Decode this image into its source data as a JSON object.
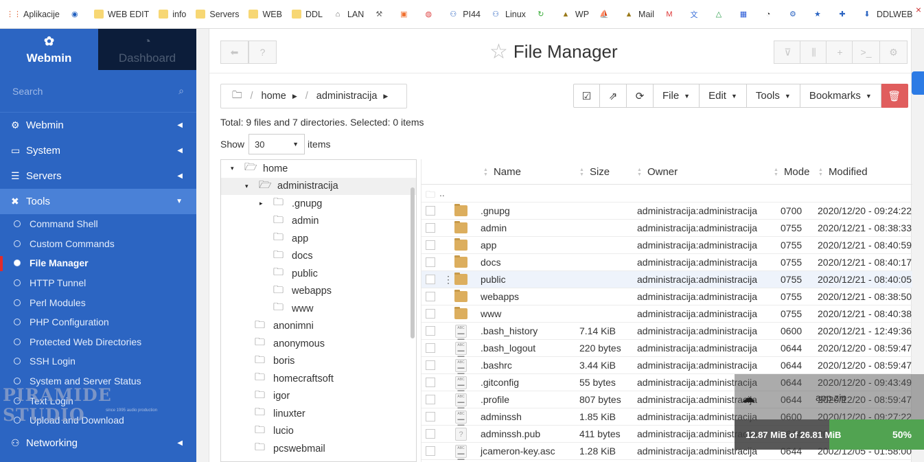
{
  "bookmarks": [
    {
      "label": "Aplikacije",
      "icon": "apps-grid-icon"
    },
    {
      "label": "",
      "icon": "radio-icon"
    },
    {
      "label": "WEB EDIT",
      "icon": "folder-icon"
    },
    {
      "label": "info",
      "icon": "folder-icon"
    },
    {
      "label": "Servers",
      "icon": "folder-icon"
    },
    {
      "label": "WEB",
      "icon": "folder-icon"
    },
    {
      "label": "DDL",
      "icon": "folder-icon"
    },
    {
      "label": "LAN",
      "icon": "lan-icon"
    },
    {
      "label": "",
      "icon": "tools-icon"
    },
    {
      "label": "",
      "icon": "box-icon"
    },
    {
      "label": "",
      "icon": "circle-logo-icon"
    },
    {
      "label": "PI44",
      "icon": "network-icon"
    },
    {
      "label": "Linux",
      "icon": "network-icon"
    },
    {
      "label": "",
      "icon": "refresh-green-icon"
    },
    {
      "label": "WP",
      "icon": "triangle-icon"
    },
    {
      "label": "",
      "icon": "pma-icon"
    },
    {
      "label": "Mail",
      "icon": "triangle-icon"
    },
    {
      "label": "",
      "icon": "gmail-icon"
    },
    {
      "label": "",
      "icon": "translate-icon"
    },
    {
      "label": "",
      "icon": "drive-icon"
    },
    {
      "label": "",
      "icon": "calendar-icon"
    },
    {
      "label": "",
      "icon": "gauge-icon"
    },
    {
      "label": "",
      "icon": "gear-icon"
    },
    {
      "label": "",
      "icon": "star-icon"
    },
    {
      "label": "",
      "icon": "puzzle-icon"
    },
    {
      "label": "DDLWEB",
      "icon": "download-icon"
    }
  ],
  "sidebar": {
    "tab_webmin": "Webmin",
    "tab_dashboard": "Dashboard",
    "search_placeholder": "Search",
    "categories_top": [
      {
        "label": "Webmin",
        "icon": "gear-icon"
      },
      {
        "label": "System",
        "icon": "monitor-icon"
      },
      {
        "label": "Servers",
        "icon": "servers-icon"
      }
    ],
    "tools_label": "Tools",
    "tools_items": [
      "Command Shell",
      "Custom Commands",
      "File Manager",
      "HTTP Tunnel",
      "Perl Modules",
      "PHP Configuration",
      "Protected Web Directories",
      "SSH Login",
      "System and Server Status",
      "Text Login",
      "Upload and Download"
    ],
    "networking_label": "Networking",
    "watermark": "PIRAMIDE STUDIO",
    "watermark_sub": "since 1995 audio production"
  },
  "main": {
    "title": "File Manager",
    "breadcrumb": {
      "home": "home",
      "folder": "administracija"
    },
    "actions": {
      "file": "File",
      "edit": "Edit",
      "tools": "Tools",
      "bookmarks": "Bookmarks"
    },
    "summary": "Total: 9 files and 7 directories. Selected: 0 items",
    "show_label": "Show",
    "per_page": "30",
    "items_label": "items"
  },
  "tree": [
    {
      "label": "home",
      "level": 0,
      "expanded": true,
      "toggle": "▾"
    },
    {
      "label": "administracija",
      "level": 1,
      "expanded": true,
      "toggle": "▾",
      "selected": true
    },
    {
      "label": ".gnupg",
      "level": 2,
      "toggle": "▸"
    },
    {
      "label": "admin",
      "level": 2,
      "toggle": ""
    },
    {
      "label": "app",
      "level": 2,
      "toggle": ""
    },
    {
      "label": "docs",
      "level": 2,
      "toggle": ""
    },
    {
      "label": "public",
      "level": 2,
      "toggle": ""
    },
    {
      "label": "webapps",
      "level": 2,
      "toggle": ""
    },
    {
      "label": "www",
      "level": 2,
      "toggle": ""
    },
    {
      "label": "anonimni",
      "level": 1,
      "toggle": ""
    },
    {
      "label": "anonymous",
      "level": 1,
      "toggle": ""
    },
    {
      "label": "boris",
      "level": 1,
      "toggle": ""
    },
    {
      "label": "homecraftsoft",
      "level": 1,
      "toggle": ""
    },
    {
      "label": "igor",
      "level": 1,
      "toggle": ""
    },
    {
      "label": "linuxter",
      "level": 1,
      "toggle": ""
    },
    {
      "label": "lucio",
      "level": 1,
      "toggle": ""
    },
    {
      "label": "pcswebmail",
      "level": 1,
      "toggle": ""
    }
  ],
  "table": {
    "columns": {
      "name": "Name",
      "size": "Size",
      "owner": "Owner",
      "mode": "Mode",
      "modified": "Modified"
    },
    "parent": "..",
    "rows": [
      {
        "name": ".gnupg",
        "size": "",
        "owner": "administracija:administracija",
        "mode": "0700",
        "modified": "2020/12/20 - 09:24:22",
        "type": "dir"
      },
      {
        "name": "admin",
        "size": "",
        "owner": "administracija:administracija",
        "mode": "0755",
        "modified": "2020/12/21 - 08:38:33",
        "type": "dir"
      },
      {
        "name": "app",
        "size": "",
        "owner": "administracija:administracija",
        "mode": "0755",
        "modified": "2020/12/21 - 08:40:59",
        "type": "dir"
      },
      {
        "name": "docs",
        "size": "",
        "owner": "administracija:administracija",
        "mode": "0755",
        "modified": "2020/12/21 - 08:40:17",
        "type": "dir"
      },
      {
        "name": "public",
        "size": "",
        "owner": "administracija:administracija",
        "mode": "0755",
        "modified": "2020/12/21 - 08:40:05",
        "type": "dir",
        "hover": true
      },
      {
        "name": "webapps",
        "size": "",
        "owner": "administracija:administracija",
        "mode": "0755",
        "modified": "2020/12/21 - 08:38:50",
        "type": "dir"
      },
      {
        "name": "www",
        "size": "",
        "owner": "administracija:administracija",
        "mode": "0755",
        "modified": "2020/12/21 - 08:40:38",
        "type": "dir"
      },
      {
        "name": ".bash_history",
        "size": "7.14 KiB",
        "owner": "administracija:administracija",
        "mode": "0600",
        "modified": "2020/12/21 - 12:49:36",
        "type": "text"
      },
      {
        "name": ".bash_logout",
        "size": "220 bytes",
        "owner": "administracija:administracija",
        "mode": "0644",
        "modified": "2020/12/20 - 08:59:47",
        "type": "text"
      },
      {
        "name": ".bashrc",
        "size": "3.44 KiB",
        "owner": "administracija:administracija",
        "mode": "0644",
        "modified": "2020/12/20 - 08:59:47",
        "type": "text"
      },
      {
        "name": ".gitconfig",
        "size": "55 bytes",
        "owner": "administracija:administracija",
        "mode": "0644",
        "modified": "2020/12/20 - 09:43:49",
        "type": "text"
      },
      {
        "name": ".profile",
        "size": "807 bytes",
        "owner": "administracija:administracija",
        "mode": "0644",
        "modified": "2020/12/20 - 08:59:47",
        "type": "text"
      },
      {
        "name": "adminssh",
        "size": "1.85 KiB",
        "owner": "administracija:administracija",
        "mode": "0600",
        "modified": "2020/12/20 - 09:27:22",
        "type": "text"
      },
      {
        "name": "adminssh.pub",
        "size": "411 bytes",
        "owner": "administracija:administracija",
        "mode": "0644",
        "modified": "2020/12/20 - 09:27:22",
        "type": "unknown"
      },
      {
        "name": "jcameron-key.asc",
        "size": "1.28 KiB",
        "owner": "administracija:administracija",
        "mode": "0644",
        "modified": "2002/12/05 - 01:58:00",
        "type": "text"
      }
    ]
  },
  "upload": {
    "filename": "app.zip",
    "progress_text": "12.87 MiB of 26.81 MiB",
    "percent_label": "50%",
    "fraction": 0.5
  },
  "colors": {
    "sidebar": "#2c65c2",
    "accent_red": "#e05d5d",
    "progress": "#51a351"
  }
}
